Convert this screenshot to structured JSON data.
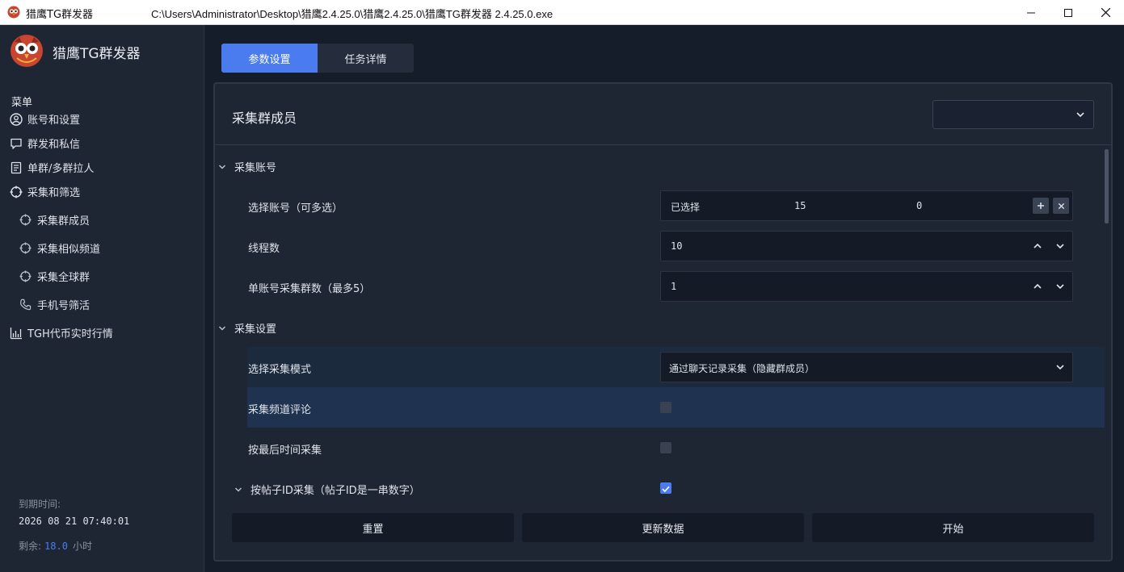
{
  "window": {
    "app_name": "猎鹰TG群发器",
    "path": "C:\\Users\\Administrator\\Desktop\\猎鹰2.4.25.0\\猎鹰2.4.25.0\\猎鹰TG群发器 2.4.25.0.exe",
    "icons": [
      "minimize-icon",
      "maximize-icon",
      "close-icon"
    ]
  },
  "sidebar": {
    "brand": "猎鹰TG群发器",
    "menu_title": "菜单",
    "items": [
      {
        "label": "账号和设置",
        "icon": "user-circle-icon"
      },
      {
        "label": "群发和私信",
        "icon": "chat-bubble-icon"
      },
      {
        "label": "单群/多群拉人",
        "icon": "document-icon"
      },
      {
        "label": "采集和筛选",
        "icon": "crosshair-icon"
      },
      {
        "label": "采集群成员",
        "icon": "crosshair-icon"
      },
      {
        "label": "采集相似频道",
        "icon": "crosshair-icon"
      },
      {
        "label": "采集全球群",
        "icon": "crosshair-icon"
      },
      {
        "label": "手机号筛活",
        "icon": "phone-icon"
      },
      {
        "label": "TGH代币实时行情",
        "icon": "chart-icon"
      }
    ],
    "expire_label": "到期时间:",
    "expire_value": "2026 08 21 07:40:01",
    "remain_label": "剩余:",
    "remain_value": "18.0",
    "remain_unit": "小时"
  },
  "tabs": [
    {
      "label": "参数设置",
      "active": true
    },
    {
      "label": "任务详情",
      "active": false
    }
  ],
  "panel": {
    "title": "采集群成员",
    "select_value": "",
    "sections": {
      "account": "采集账号",
      "settings": "采集设置"
    },
    "rows": {
      "select_account": {
        "label": "选择账号（可多选）",
        "selected_text": "已选择",
        "count": "15",
        "extra": "0"
      },
      "threads": {
        "label": "线程数",
        "value": "10"
      },
      "groups_per_account": {
        "label": "单账号采集群数（最多5）",
        "value": "1"
      },
      "mode": {
        "label": "选择采集模式",
        "value": "通过聊天记录采集（隐藏群成员）"
      },
      "channel_comments": {
        "label": "采集频道评论",
        "checked": false
      },
      "last_time": {
        "label": "按最后时间采集",
        "checked": false
      },
      "post_id": {
        "label": "按帖子ID采集（帖子ID是一串数字）",
        "checked": true
      }
    },
    "buttons": {
      "reset": "重置",
      "update": "更新数据",
      "start": "开始"
    }
  },
  "colors": {
    "accent": "#4a7cf0",
    "sidebar_bg": "#1e2533",
    "main_bg": "#161d2a",
    "highlight_row": "#1f3350"
  }
}
